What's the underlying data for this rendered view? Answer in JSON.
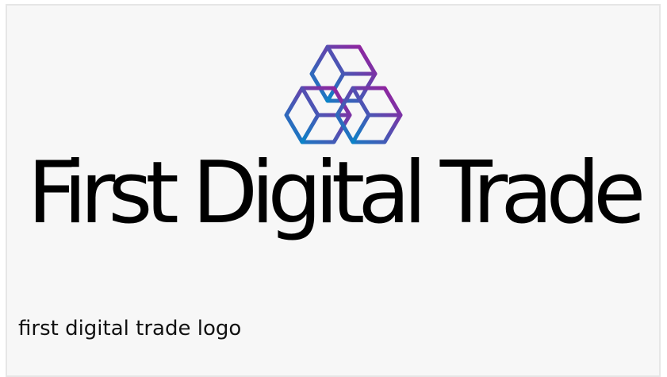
{
  "logo": {
    "brand_name": "First Digital Trade",
    "icon": "stacked-cubes-icon",
    "gradient": {
      "start": "#0a84c8",
      "end": "#a0199a"
    }
  },
  "caption": {
    "text": "first digital trade logo"
  },
  "colors": {
    "background": "#f7f7f7",
    "border": "#e6e6e6",
    "text": "#000000"
  }
}
